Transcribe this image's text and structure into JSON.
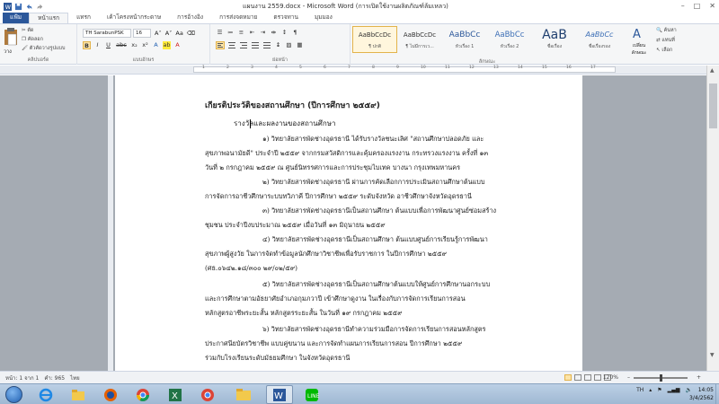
{
  "window": {
    "title": "แผนงาน 2559.docx - Microsoft Word (การเปิดใช้งานผลิตภัณฑ์ล้มเหลว)",
    "controls": [
      "–",
      "□",
      "✕"
    ]
  },
  "ribbon_tabs": [
    "แฟ้ม",
    "หน้าแรก",
    "แทรก",
    "เค้าโครงหน้ากระดาษ",
    "การอ้างอิง",
    "การส่งจดหมาย",
    "ตรวจทาน",
    "มุมมอง"
  ],
  "clipboard": {
    "paste": "วาง",
    "cut": "ตัด",
    "copy": "คัดลอก",
    "format_painter": "ตัวคัดวางรูปแบบ"
  },
  "font": {
    "name": "TH SarabunPSK",
    "size": "16",
    "bold": "B",
    "italic": "I",
    "underline": "U",
    "strike": "abc",
    "sub": "x₂",
    "sup": "x²"
  },
  "styles": [
    {
      "sample": "AaBbCcDc",
      "name": "¶ ปกติ"
    },
    {
      "sample": "AaBbCcDc",
      "name": "¶ ไม่มีการเว..."
    },
    {
      "sample": "AaBbCc",
      "name": "หัวเรื่อง 1"
    },
    {
      "sample": "AaBbCc",
      "name": "หัวเรื่อง 2"
    },
    {
      "sample": "AaB",
      "name": "ชื่อเรื่อง"
    },
    {
      "sample": "AaBbCc",
      "name": "ชื่อเรื่องรอง"
    },
    {
      "sample": "AaBbCcDc",
      "name": "ตัวเน้นอ่อน"
    }
  ],
  "change_styles": "เปลี่ยนลักษณะ",
  "editing": [
    "ค้นหา",
    "แทนที่",
    "เลือก"
  ],
  "ribbon_groups": [
    "คลิปบอร์ด",
    "แบบอักษร",
    "ย่อหน้า",
    "ลักษณะ",
    "การแก้ไข"
  ],
  "ruler_numbers": [
    "1",
    "2",
    "3",
    "4",
    "5",
    "6",
    "7",
    "8",
    "9",
    "10",
    "11",
    "12",
    "13",
    "14",
    "15",
    "16",
    "17"
  ],
  "document": {
    "title": "เกียรติประวัติของสถานศึกษา (ปีการศึกษา ๒๕๕๙)",
    "subtitle": "รางวัลและผลงานของสถานศึกษา",
    "lines": [
      "๑) วิทยาลัยสารพัดช่างอุดรธานี ได้รับรางวัลชนะเลิศ \"สถานศึกษาปลอดภัย และ",
      "สุขภาพอนามัยดี\" ประจำปี ๒๕๕๙ จากกรมสวัสดิการและคุ้มครองแรงงาน กระทรวงแรงงาน ครั้งที่ ๑๓",
      "วันที่ ๒ กรกฎาคม ๒๕๕๙ ณ ศูนย์นิทรรศการและการประชุมไบเทค บางนา กรุงเทพมหานคร",
      "๒) วิทยาลัยสารพัดช่างอุดรธานี ผ่านการคัดเลือกการประเมินสถานศึกษาต้นแบบ",
      "การจัดการอาชีวศึกษาระบบทวิภาคี ปีการศึกษา ๒๕๕๙ ระดับจังหวัด อาชีวศึกษาจังหวัดอุดรธานี",
      "๓) วิทยาลัยสารพัดช่างอุดรธานีเป็นสถานศึกษา ต้นแบบเพื่อการพัฒนาศูนย์ซ่อมสร้าง",
      "ชุมชน ประจำปีงบประมาณ ๒๕๕๙ เมื่อวันที่ ๑๓ มิถุนายน ๒๕๕๙",
      "๔) วิทยาลัยสารพัดช่างอุดรธานีเป็นสถานศึกษา ต้นแบบศูนย์การเรียนรู้การพัฒนา",
      "สุขภาพผู้สูงวัย ในการจัดทำข้อมูลนักศึกษาวิชาชีพเพื่อรับราชการ ในปีการศึกษา ๒๕๕๙",
      "(ศธ.๐๖๔๒.๑๘/๓๐๐ ๒๙/๐๒/๕๙)",
      "๕) วิทยาลัยสารพัดช่างอุดรธานีเป็นสถานศึกษาต้นแบบให้ศูนย์การศึกษานอกระบบ",
      "และการศึกษาตามอัธยาศัยอำเภอกุมภวาปี เข้าศึกษาดูงาน ในเรื่องกับการจัดการเรียนการสอน",
      "หลักสูตรอาชีพระยะสั้น หลักสูตรระยะสั้น ในวันที่ ๑๙ กรกฎาคม ๒๕๕๙",
      "๖) วิทยาลัยสารพัดช่างอุดรธานีทำความร่วมมือการจัดการเรียนการสอนหลักสูตร",
      "ประกาศนียบัตรวิชาชีพ แบบคู่ขนาน และการจัดทำแผนการเรียนการสอน ปีการศึกษา ๒๕๕๙",
      "ร่วมกับโรงเรียนระดับมัธยมศึกษา ในจังหวัดอุดรธานี"
    ]
  },
  "status_bar": {
    "page": "หน้า: 1 จาก 1",
    "words": "คำ: 965",
    "language": "ไทย",
    "zoom": "120%"
  },
  "taskbar": {
    "apps": [
      "ie-icon",
      "folder-icon",
      "firefox-icon",
      "chrome-icon",
      "excel-icon",
      "chrome2-icon",
      "explorer-icon",
      "word-icon",
      "line-icon"
    ],
    "tray_lang": "TH",
    "time": "14:05",
    "date": "3/4/2562"
  },
  "colors": {
    "file_tab": "#2b579a",
    "ribbon_bg": "#f5f6f7",
    "doc_bg": "#a5abb3",
    "taskbar": "#bcd0e5"
  }
}
